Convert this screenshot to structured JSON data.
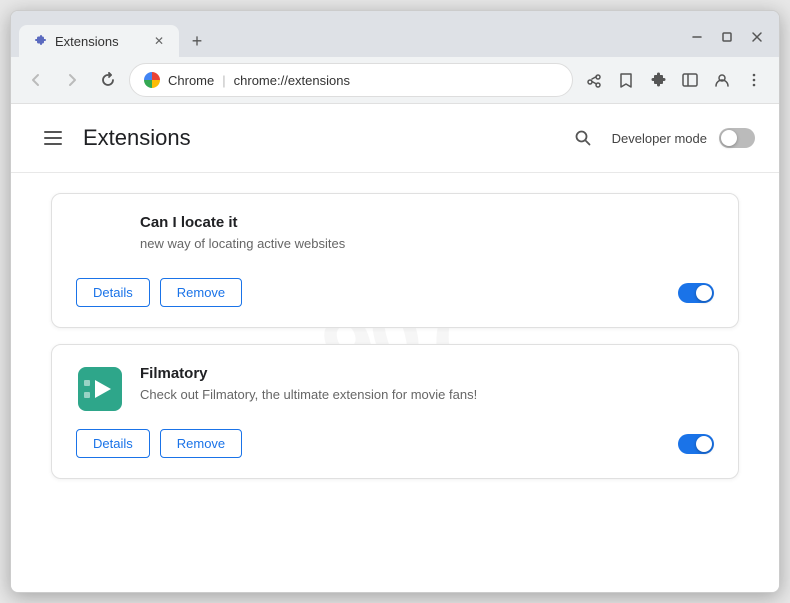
{
  "window": {
    "title": "Extensions",
    "url_brand": "Chrome",
    "url_path": "chrome://extensions",
    "tab_label": "Extensions"
  },
  "window_controls": {
    "minimize": "─",
    "maximize": "□",
    "close": "✕"
  },
  "toolbar": {
    "back_label": "←",
    "forward_label": "→",
    "reload_label": "↻"
  },
  "extensions_page": {
    "title": "Extensions",
    "developer_mode_label": "Developer mode",
    "developer_mode_on": false
  },
  "extensions": [
    {
      "id": "ext-1",
      "name": "Can I locate it",
      "description": "new way of locating active websites",
      "enabled": true,
      "details_label": "Details",
      "remove_label": "Remove"
    },
    {
      "id": "ext-2",
      "name": "Filmatory",
      "description": "Check out Filmatory, the ultimate extension for movie fans!",
      "enabled": true,
      "details_label": "Details",
      "remove_label": "Remove"
    }
  ]
}
